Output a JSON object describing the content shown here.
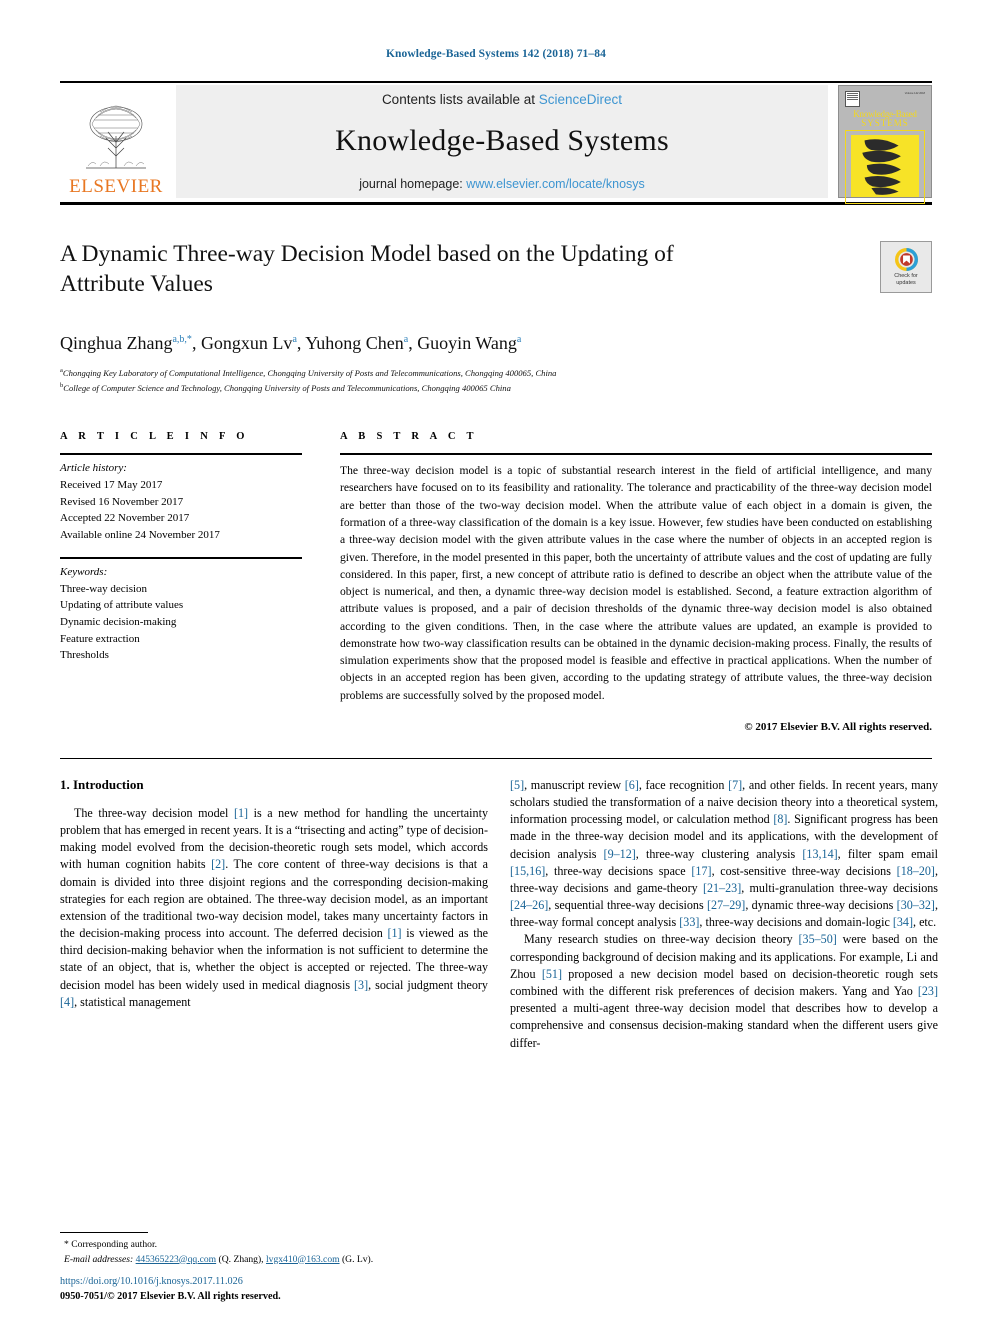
{
  "running_head": "Knowledge-Based Systems 142 (2018) 71–84",
  "masthead": {
    "contents_prefix": "Contents lists available at ",
    "contents_link": "ScienceDirect",
    "journal_name": "Knowledge-Based Systems",
    "homepage_prefix": "journal homepage: ",
    "homepage_link": "www.elsevier.com/locate/knosys",
    "publisher": "ELSEVIER",
    "cover": {
      "title_line1": "Knowledge-Based",
      "title_line2": "SYSTEMS",
      "mini_caption": "Volume 142 2018"
    }
  },
  "article": {
    "title": "A Dynamic Three-way Decision Model based on the Updating of Attribute Values",
    "crossmark": {
      "line1": "Check for",
      "line2": "updates"
    },
    "authors": [
      {
        "name": "Qinghua Zhang",
        "marks": "a,b,*"
      },
      {
        "name": "Gongxun Lv",
        "marks": "a"
      },
      {
        "name": "Yuhong Chen",
        "marks": "a"
      },
      {
        "name": "Guoyin Wang",
        "marks": "a"
      }
    ],
    "affiliations": [
      {
        "mark": "a",
        "text": "Chongqing Key Laboratory of Computational Intelligence, Chongqing University of Posts and Telecommunications, Chongqing 400065, China"
      },
      {
        "mark": "b",
        "text": "College of Computer Science and Technology, Chongqing University of Posts and Telecommunications, Chongqing 400065 China"
      }
    ]
  },
  "article_info": {
    "heading": "A R T I C L E  I N F O",
    "history_label": "Article history:",
    "history": [
      "Received 17 May 2017",
      "Revised 16 November 2017",
      "Accepted 22 November 2017",
      "Available online 24 November 2017"
    ],
    "keywords_label": "Keywords:",
    "keywords": [
      "Three-way decision",
      "Updating of attribute values",
      "Dynamic decision-making",
      "Feature extraction",
      "Thresholds"
    ]
  },
  "abstract": {
    "heading": "A B S T R A C T",
    "text": "The three-way decision model is a topic of substantial research interest in the field of artificial intelligence, and many researchers have focused on to its feasibility and rationality. The tolerance and practicability of the three-way decision model are better than those of the two-way decision model. When the attribute value of each object in a domain is given, the formation of a three-way classification of the domain is a key issue. However, few studies have been conducted on establishing a three-way decision model with the given attribute values in the case where the number of objects in an accepted region is given. Therefore, in the model presented in this paper, both the uncertainty of attribute values and the cost of updating are fully considered. In this paper, first, a new concept of attribute ratio is defined to describe an object when the attribute value of the object is numerical, and then, a dynamic three-way decision model is established. Second, a feature extraction algorithm of attribute values is proposed, and a pair of decision thresholds of the dynamic three-way decision model is also obtained according to the given conditions. Then, in the case where the attribute values are updated, an example is provided to demonstrate how two-way classification results can be obtained in the dynamic decision-making process. Finally, the results of simulation experiments show that the proposed model is feasible and effective in practical applications. When the number of objects in an accepted region has been given, according to the updating strategy of attribute values, the three-way decision problems are successfully solved by the proposed model.",
    "copyright": "© 2017 Elsevier B.V. All rights reserved."
  },
  "introduction": {
    "heading": "1. Introduction",
    "left_paragraph_1_parts": [
      "The three-way decision model ",
      "[1]",
      " is a new method for handling the uncertainty problem that has emerged in recent years. It is a “trisecting and acting” type of decision-making model evolved from the decision-theoretic rough sets model, which accords with human cognition habits ",
      "[2]",
      ". The core content of three-way decisions is that a domain is divided into three disjoint regions and the corresponding decision-making strategies for each region are obtained. The three-way decision model, as an important extension of the traditional two-way decision model, takes many uncertainty factors in the decision-making process into account. The deferred decision ",
      "[1]",
      " is viewed as the third decision-making behavior when the information is not sufficient to determine the state of an object, that is, whether the object is accepted or rejected. The three-way decision model has been widely used in medical diagnosis ",
      "[3]",
      ", social judgment theory ",
      "[4]",
      ", statistical management ",
      "[5]",
      ", manuscript review ",
      "[6]",
      ", face recognition ",
      "[7]",
      ", and other fields. In recent years, many scholars studied the transformation of a naive decision theory into a theoretical system, information processing model, or calculation method ",
      "[8]",
      ". Significant progress has been made in the three-way decision model and its applications, with the development of decision analysis ",
      "[9–12]",
      ", three-way clustering analysis ",
      "[13,14]",
      ", filter spam email ",
      "[15,16]",
      ", three-way decisions space ",
      "[17]",
      ", cost-sensitive three-way decisions ",
      "[18–20]",
      ", three-way decisions and game-theory ",
      "[21–23]",
      ", multi-granulation three-way decisions ",
      "[24–26]",
      ", sequential three-way decisions ",
      "[27–29]",
      ", dynamic three-way decisions ",
      "[30–32]",
      ", three-way formal concept analysis ",
      "[33]",
      ", three-way decisions and domain-logic ",
      "[34]",
      ", etc."
    ],
    "right_paragraph_2_parts": [
      "Many research studies on three-way decision theory ",
      "[35–50]",
      " were based on the corresponding background of decision making and its applications. For example, Li and Zhou ",
      "[51]",
      " proposed a new decision model based on decision-theoretic rough sets combined with the different risk preferences of decision makers. Yang and Yao ",
      "[23]",
      " presented a multi-agent three-way decision model that describes how to develop a comprehensive and consensus decision-making standard when the different users give differ-"
    ]
  },
  "footnote": {
    "corresponding_marker": "*",
    "corresponding_label": "Corresponding author.",
    "email_label": "E-mail addresses:",
    "email1": "445365223@qq.com",
    "email1_owner": "(Q. Zhang),",
    "email2": "lvgx410@163.com",
    "email2_owner": "(G. Lv)."
  },
  "footer": {
    "doi": "https://doi.org/10.1016/j.knosys.2017.11.026",
    "issn": "0950-7051/© 2017 Elsevier B.V. All rights reserved."
  },
  "colors": {
    "link": "#1a6496",
    "sciencedirect": "#3d95d1",
    "elsevier_orange": "#E87722",
    "cover_yellow": "#f7e327",
    "reference": "#1a6496"
  }
}
